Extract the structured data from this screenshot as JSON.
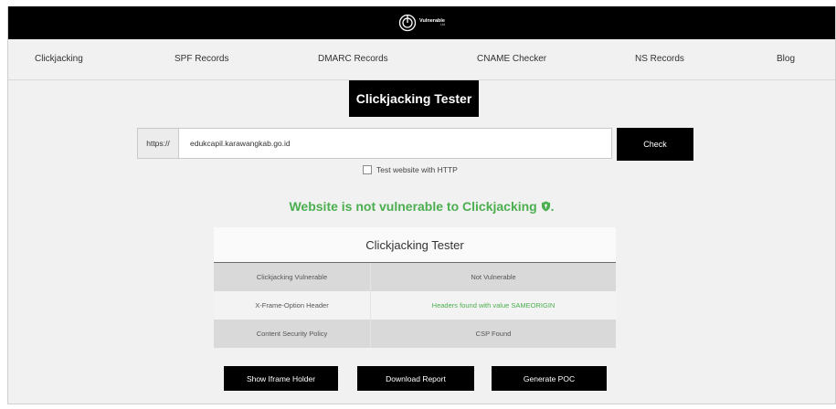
{
  "brand": {
    "name": "Vulnerable",
    "sub": "Ltd"
  },
  "nav": {
    "items": [
      {
        "label": "Clickjacking"
      },
      {
        "label": "SPF Records"
      },
      {
        "label": "DMARC Records"
      },
      {
        "label": "CNAME Checker"
      },
      {
        "label": "NS Records"
      },
      {
        "label": "Blog"
      }
    ]
  },
  "tester": {
    "title": "Clickjacking Tester",
    "prefix": "https://",
    "url_value": "edukcapil.karawangkab.go.id",
    "check_label": "Check",
    "http_label": "Test website with HTTP",
    "http_checked": false
  },
  "result": {
    "message": "Website is not vulnerable to Clickjacking",
    "color": "#4bae4f",
    "icon": "shield-icon"
  },
  "table": {
    "title": "Clickjacking Tester",
    "rows": [
      {
        "label": "Clickjacking Vulnerable",
        "value": "Not Vulnerable"
      },
      {
        "label": "X-Frame-Option Header",
        "value": "Headers found with value SAMEORIGIN"
      },
      {
        "label": "Content Security Policy",
        "value": "CSP Found"
      }
    ]
  },
  "actions": {
    "show_iframe": "Show Iframe Holder",
    "download": "Download Report",
    "generate_poc": "Generate POC"
  }
}
